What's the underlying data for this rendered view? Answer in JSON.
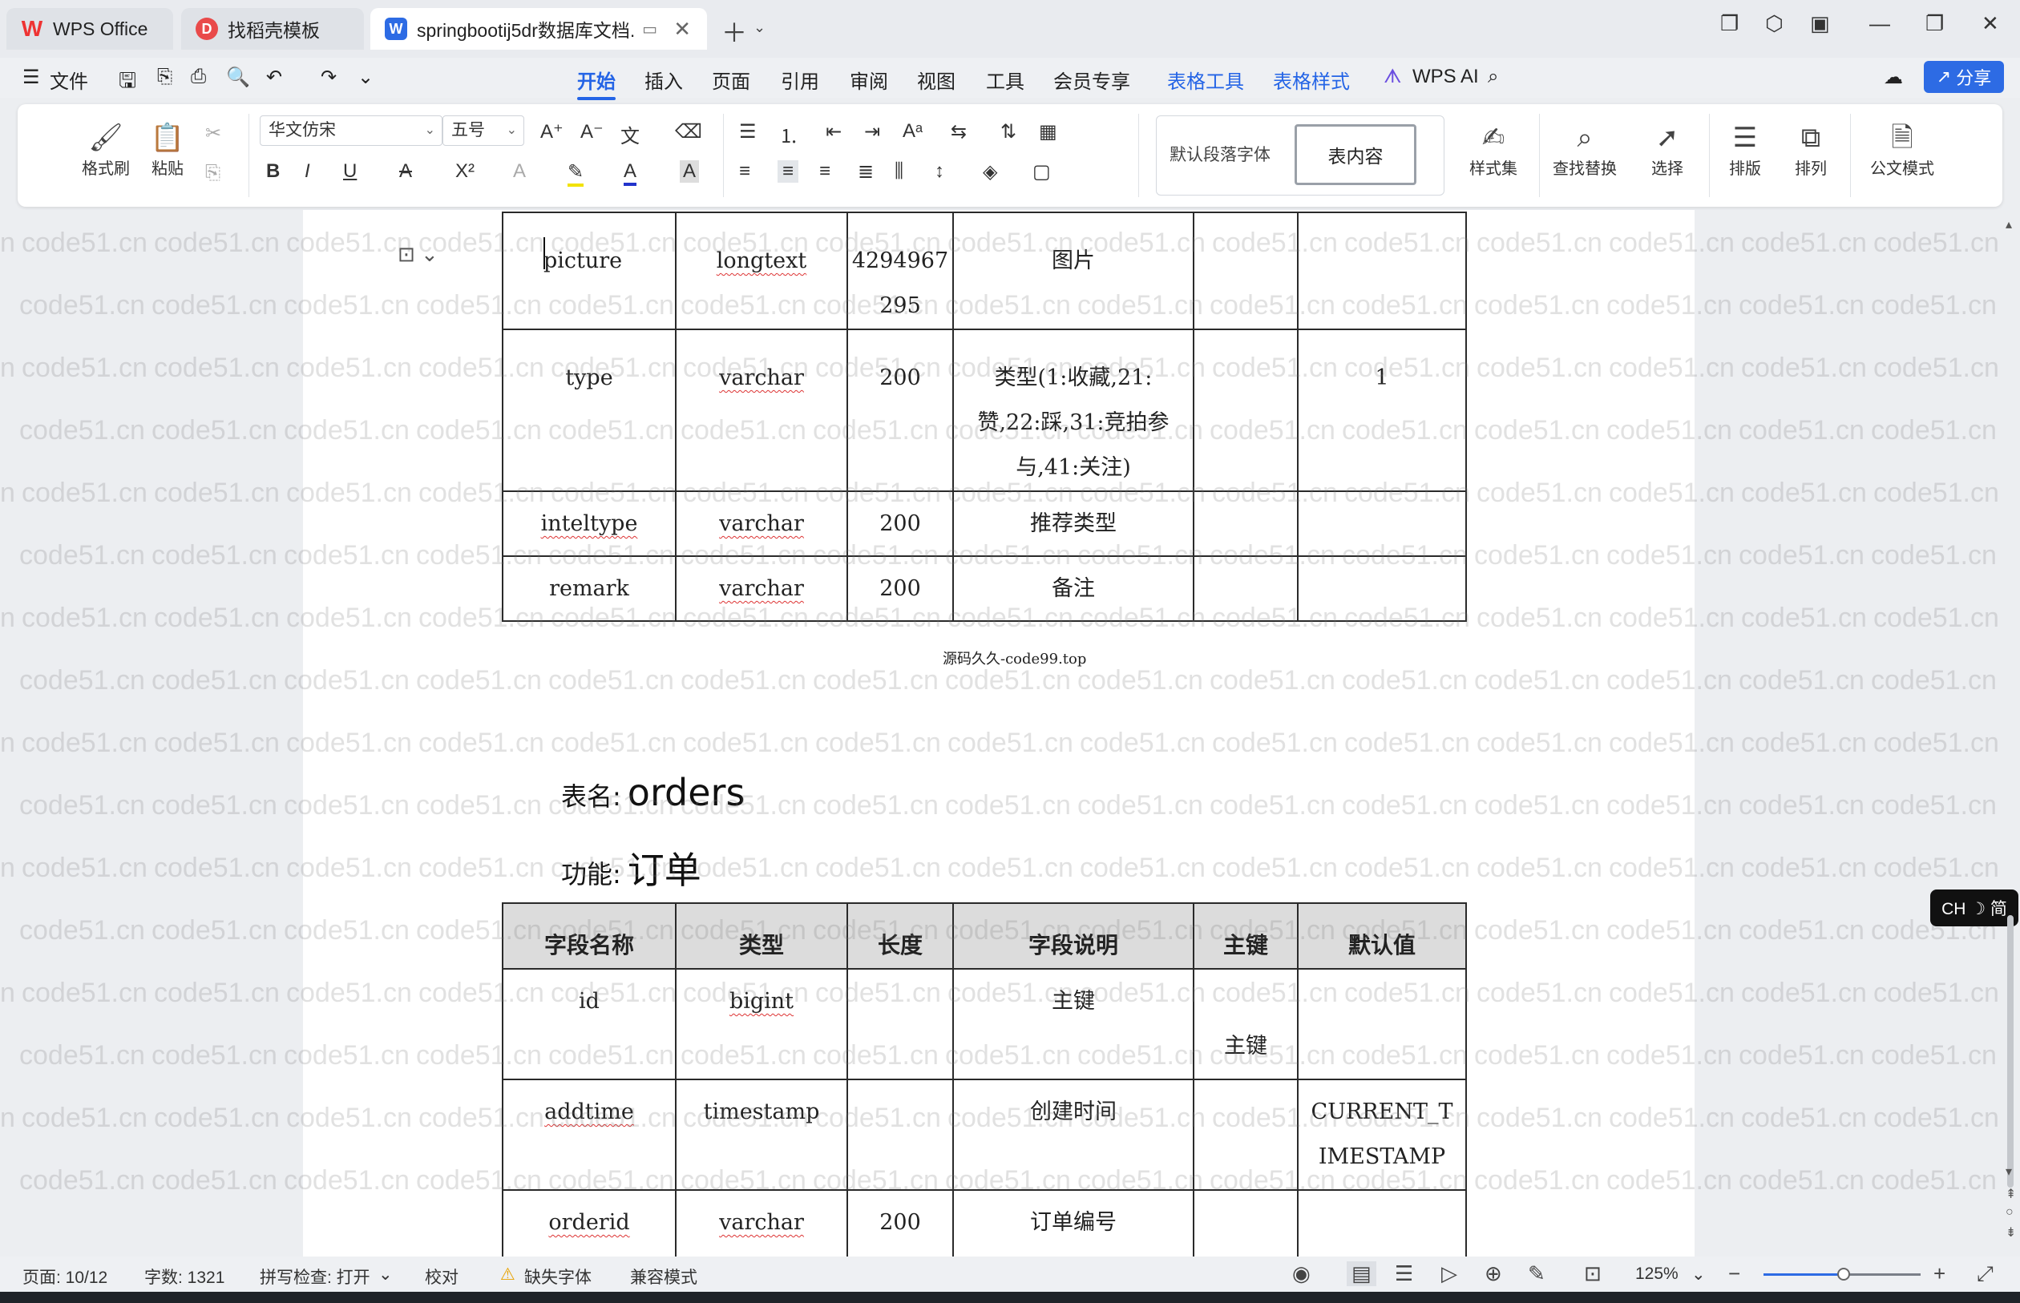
{
  "tabs": {
    "wps": "WPS Office",
    "template": "找稻壳模板",
    "document": "springbootij5dr数据库文档."
  },
  "menu": {
    "file": "文件",
    "items": [
      "开始",
      "插入",
      "页面",
      "引用",
      "审阅",
      "视图",
      "工具",
      "会员专享",
      "表格工具",
      "表格样式"
    ],
    "wps_ai": "WPS AI",
    "share": "分享"
  },
  "ribbon": {
    "format_painter": "格式刷",
    "paste": "粘贴",
    "font_name": "华文仿宋",
    "font_size": "五号",
    "style_default": "默认段落字体",
    "style_table": "表内容",
    "style_set": "样式集",
    "find_replace": "查找替换",
    "select": "选择",
    "layout": "排版",
    "arrange": "排列",
    "official_mode": "公文模式"
  },
  "table1": {
    "rows": [
      {
        "name": "picture",
        "type": "longtext",
        "length": "4294967295",
        "desc": "图片",
        "pk": "",
        "default": ""
      },
      {
        "name": "type",
        "type": "varchar",
        "length": "200",
        "desc": "类型(1:收藏,21:赞,22:踩,31:竞拍参与,41:关注)",
        "pk": "",
        "default": "1"
      },
      {
        "name": "inteltype",
        "type": "varchar",
        "length": "200",
        "desc": "推荐类型",
        "pk": "",
        "default": ""
      },
      {
        "name": "remark",
        "type": "varchar",
        "length": "200",
        "desc": "备注",
        "pk": "",
        "default": ""
      }
    ]
  },
  "caption": "源码久久-code99.top",
  "table2_meta": {
    "name_label": "表名:",
    "name_value": "orders",
    "func_label": "功能:",
    "func_value": "订单"
  },
  "table2": {
    "headers": [
      "字段名称",
      "类型",
      "长度",
      "字段说明",
      "主键",
      "默认值"
    ],
    "rows": [
      {
        "name": "id",
        "type": "bigint",
        "length": "",
        "desc": "主键",
        "pk": "主键",
        "default": ""
      },
      {
        "name": "addtime",
        "type": "timestamp",
        "length": "",
        "desc": "创建时间",
        "pk": "",
        "default": "CURRENT_TIMESTAMP"
      },
      {
        "name": "orderid",
        "type": "varchar",
        "length": "200",
        "desc": "订单编号",
        "pk": "",
        "default": ""
      }
    ]
  },
  "watermark": "code51.cn",
  "ime": "CH ☽ 简",
  "status": {
    "page": "页面: 10/12",
    "words": "字数: 1321",
    "spell": "拼写检查: 打开",
    "proof": "校对",
    "missing_font": "缺失字体",
    "compat": "兼容模式",
    "zoom": "125%"
  },
  "colors": {
    "accent": "#2464e6",
    "table_header_bg": "#dcdcdc"
  }
}
